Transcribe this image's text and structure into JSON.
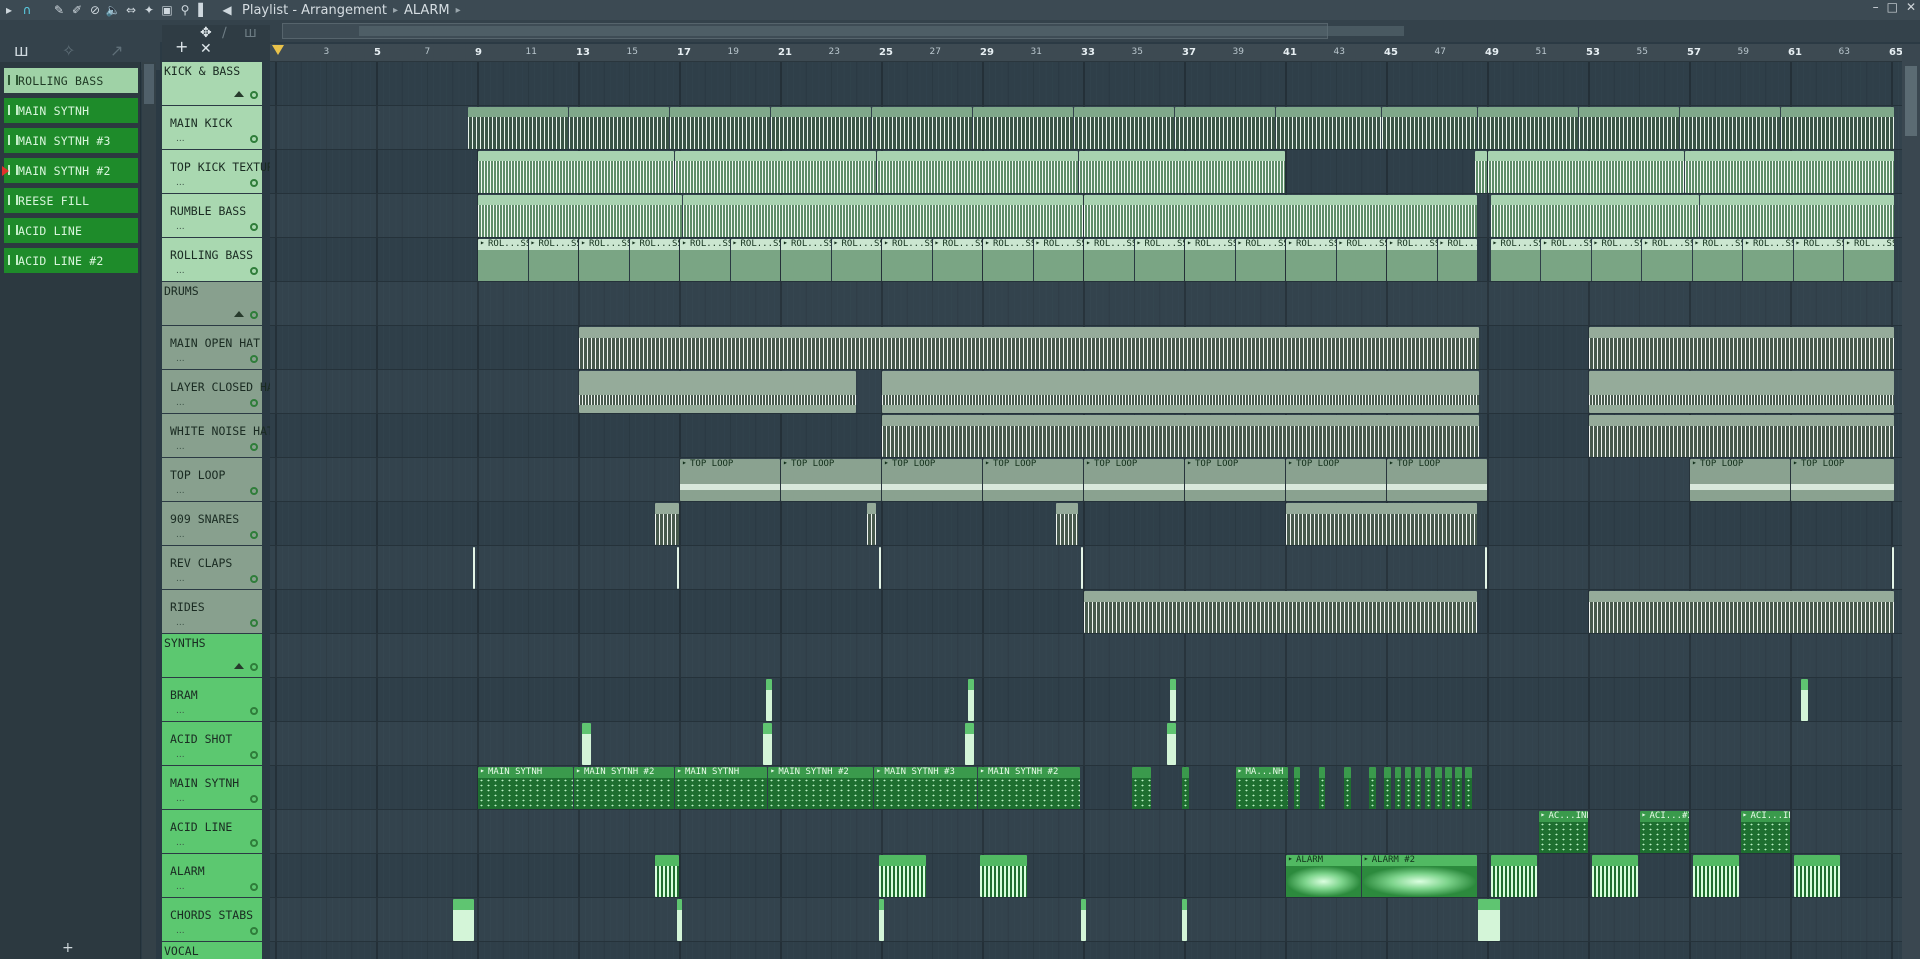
{
  "window": {
    "crumbs": [
      "Playlist - Arrangement",
      "ALARM"
    ],
    "controls": [
      "–",
      "□",
      "✕"
    ]
  },
  "picker": {
    "items": [
      "ROLLING BASS",
      "MAIN SYTNH",
      "MAIN SYTNH #3",
      "MAIN SYTNH #2",
      "REESE FILL",
      "ACID LINE",
      "ACID LINE #2"
    ],
    "selected": 0,
    "add": "+"
  },
  "ruler": [
    "3",
    "5",
    "7",
    "9",
    "11",
    "13",
    "15",
    "17",
    "19",
    "21",
    "23",
    "25",
    "27",
    "29",
    "31",
    "33",
    "35",
    "37",
    "39",
    "41",
    "43",
    "45",
    "47",
    "49",
    "51",
    "53",
    "55",
    "57",
    "59",
    "61",
    "63",
    "65"
  ],
  "tracks": [
    {
      "name": "KICK & BASS",
      "kind": "group",
      "color": "kb"
    },
    {
      "name": "MAIN KICK",
      "kind": "track",
      "color": "kb"
    },
    {
      "name": "TOP KICK TEXTURE",
      "kind": "track",
      "color": "kb"
    },
    {
      "name": "RUMBLE BASS",
      "kind": "track",
      "color": "kb"
    },
    {
      "name": "ROLLING BASS",
      "kind": "track",
      "color": "kb"
    },
    {
      "name": "DRUMS",
      "kind": "group",
      "color": "dr"
    },
    {
      "name": "MAIN OPEN HAT",
      "kind": "track",
      "color": "dr"
    },
    {
      "name": "LAYER CLOSED HAT",
      "kind": "track",
      "color": "dr"
    },
    {
      "name": "WHITE NOISE HAT",
      "kind": "track",
      "color": "dr"
    },
    {
      "name": "TOP LOOP",
      "kind": "track",
      "color": "dr"
    },
    {
      "name": "909 SNARES",
      "kind": "track",
      "color": "dr"
    },
    {
      "name": "REV CLAPS",
      "kind": "track",
      "color": "dr"
    },
    {
      "name": "RIDES",
      "kind": "track",
      "color": "dr"
    },
    {
      "name": "SYNTHS",
      "kind": "group",
      "color": "sy"
    },
    {
      "name": "BRAM",
      "kind": "track",
      "color": "sy"
    },
    {
      "name": "ACID SHOT",
      "kind": "track",
      "color": "sy"
    },
    {
      "name": "MAIN SYTNH",
      "kind": "track",
      "color": "sy"
    },
    {
      "name": "ACID LINE",
      "kind": "track",
      "color": "sy"
    },
    {
      "name": "ALARM",
      "kind": "track",
      "color": "sy"
    },
    {
      "name": "CHORDS STABS",
      "kind": "track",
      "color": "sy"
    },
    {
      "name": "VOCAL",
      "kind": "group",
      "color": "sy"
    }
  ],
  "track_dots": "...",
  "clip_labels": {
    "rolling": "ROL...SS",
    "toploop": "TOP LOOP",
    "mainsynth": [
      "MAIN SYTNH",
      "MAIN SYTNH #2",
      "MAIN SYTNH",
      "MAIN SYTNH #2",
      "MAIN SYTNH #3",
      "MAIN SYTNH #2",
      "MA...NH"
    ],
    "acidline": [
      "AC...INE",
      "ACI...#2",
      "ACI...INE"
    ],
    "alarm": [
      "ALARM",
      "ALARM #2"
    ]
  }
}
